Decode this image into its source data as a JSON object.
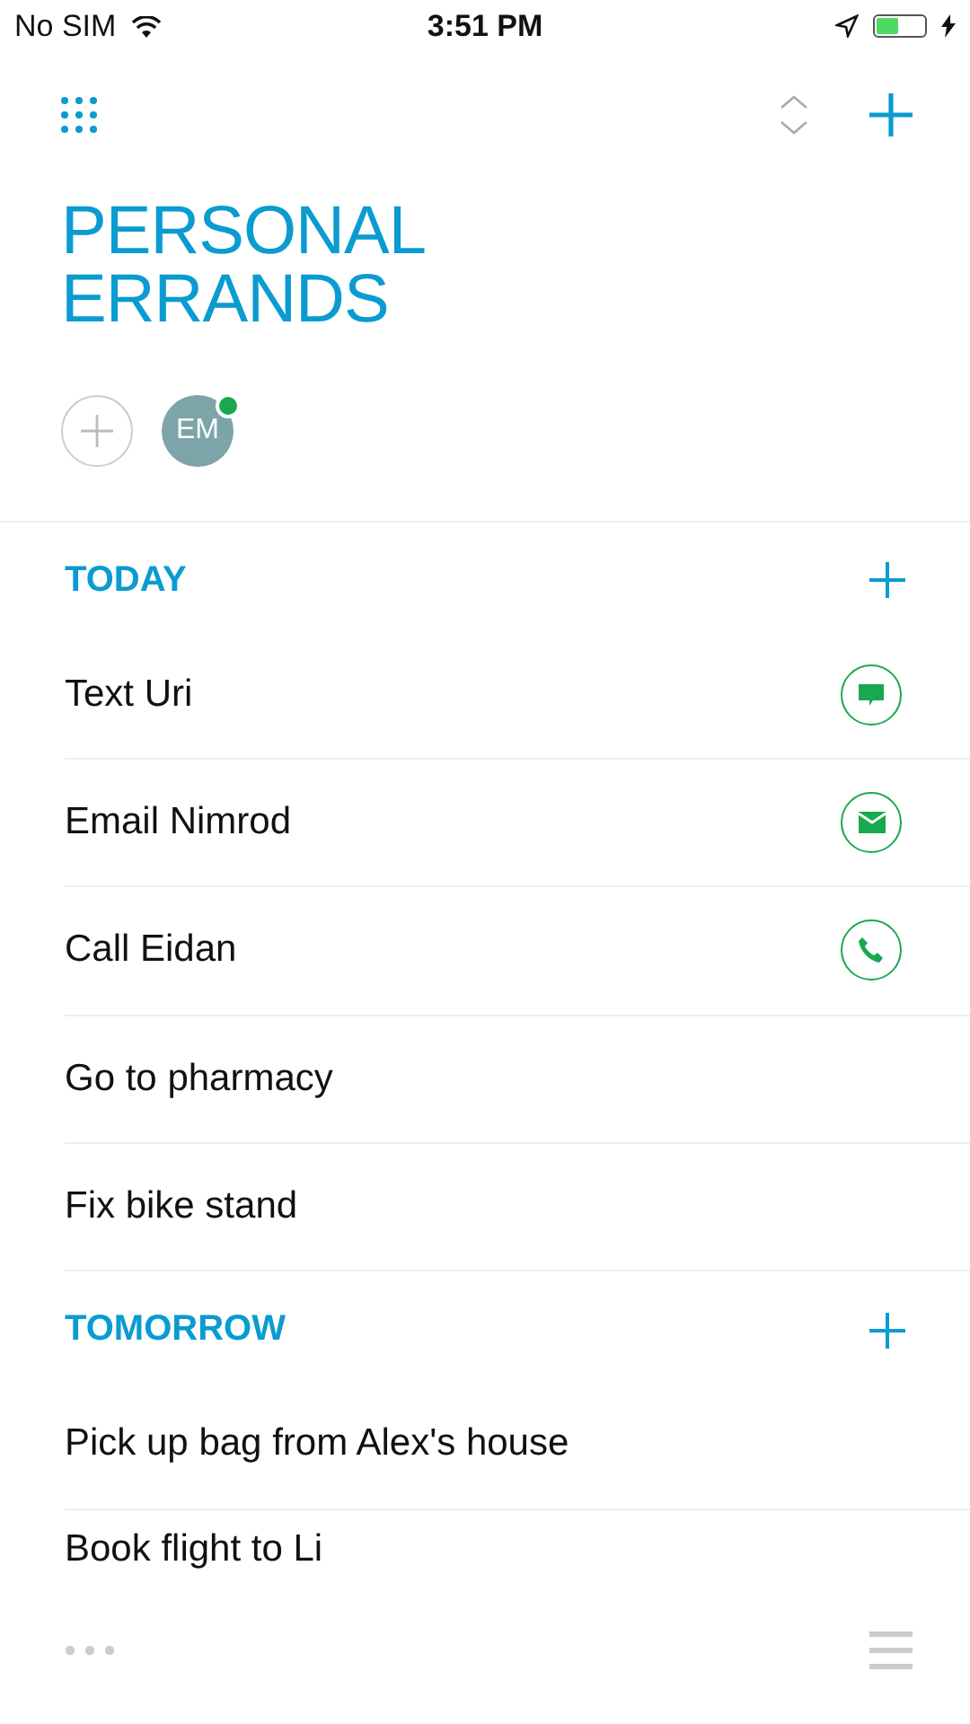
{
  "status_bar": {
    "carrier": "No SIM",
    "time": "3:51 PM",
    "charging": true
  },
  "list": {
    "title_lines": [
      "PERSONAL",
      "ERRANDS"
    ],
    "members": [
      {
        "initials": "EM",
        "online": true
      }
    ]
  },
  "sections": [
    {
      "title": "TODAY",
      "tasks": [
        {
          "text": "Text Uri",
          "kind": "message"
        },
        {
          "text": "Email Nimrod",
          "kind": "email"
        },
        {
          "text": "Call Eidan",
          "kind": "call"
        },
        {
          "text": "Go to pharmacy"
        },
        {
          "text": "Fix bike stand"
        }
      ]
    },
    {
      "title": "TOMORROW",
      "tasks": [
        {
          "text": "Pick up bag from Alex's house"
        },
        {
          "text": "Book flight to Li"
        }
      ]
    }
  ]
}
